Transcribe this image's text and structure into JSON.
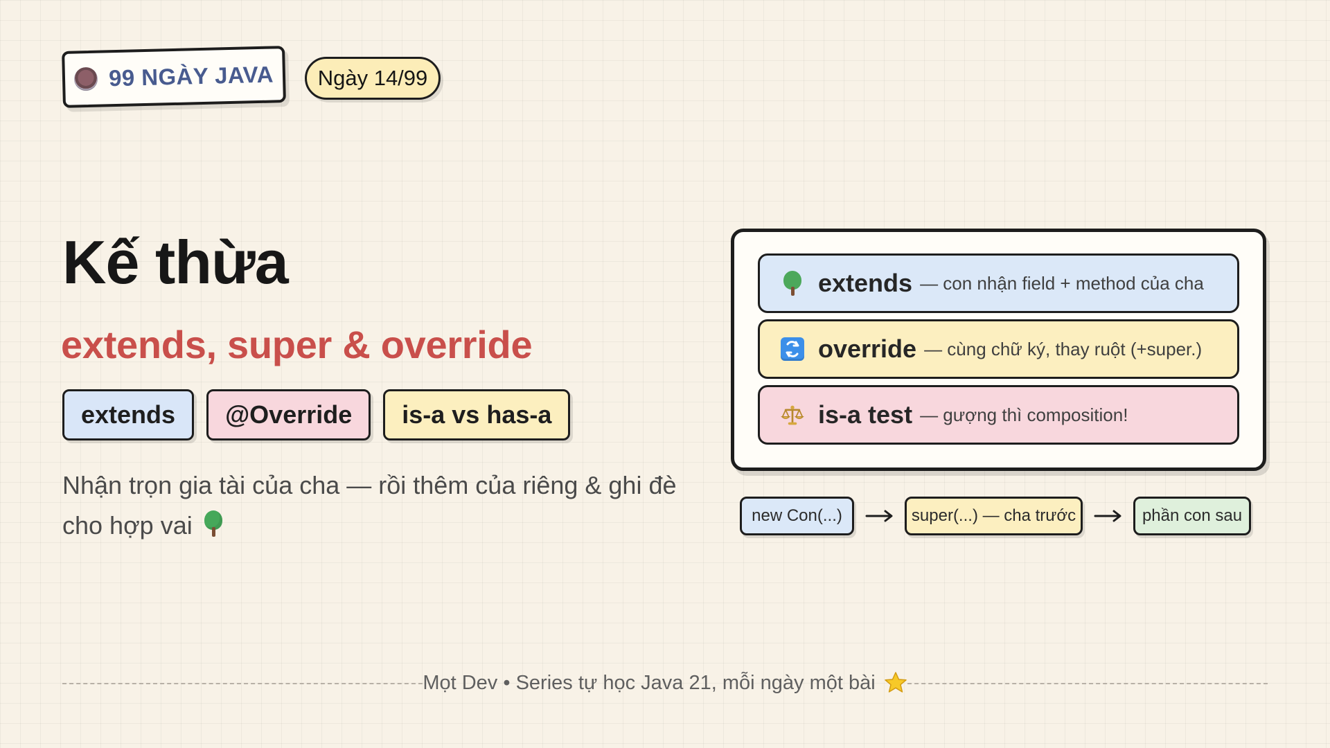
{
  "header": {
    "brand": "99 NGÀY JAVA",
    "day": "Ngày 14/99"
  },
  "hero": {
    "title": "Kế thừa",
    "subtitle": "extends, super & override",
    "tags": [
      "extends",
      "@Override",
      "is-a vs has-a"
    ],
    "description": "Nhận trọn gia tài của cha — rồi thêm của riêng & ghi đè cho hợp vai"
  },
  "concepts": [
    {
      "name": "extends",
      "description": "— con nhận field + method của cha",
      "icon": "tree-icon",
      "color": "#dbe8f8"
    },
    {
      "name": "override",
      "description": "— cùng chữ ký, thay ruột (+super.)",
      "icon": "refresh-icon",
      "color": "#fcefc0"
    },
    {
      "name": "is-a test",
      "description": "— gượng thì composition!",
      "icon": "scale-icon",
      "color": "#f8d7dd"
    }
  ],
  "flow": [
    "new Con(...)",
    "super(...) — cha trước",
    "phần con sau"
  ],
  "footer": {
    "text": "Mọt Dev • Series tự học Java 21, mỗi ngày một bài"
  },
  "colors": {
    "accent_red": "#c94f4b",
    "blue_card": "#dbe8f8",
    "yellow_card": "#fcefc0",
    "pink_card": "#f8d7dd",
    "green_card": "#dff0dc",
    "brand_blue": "#485b8f"
  }
}
